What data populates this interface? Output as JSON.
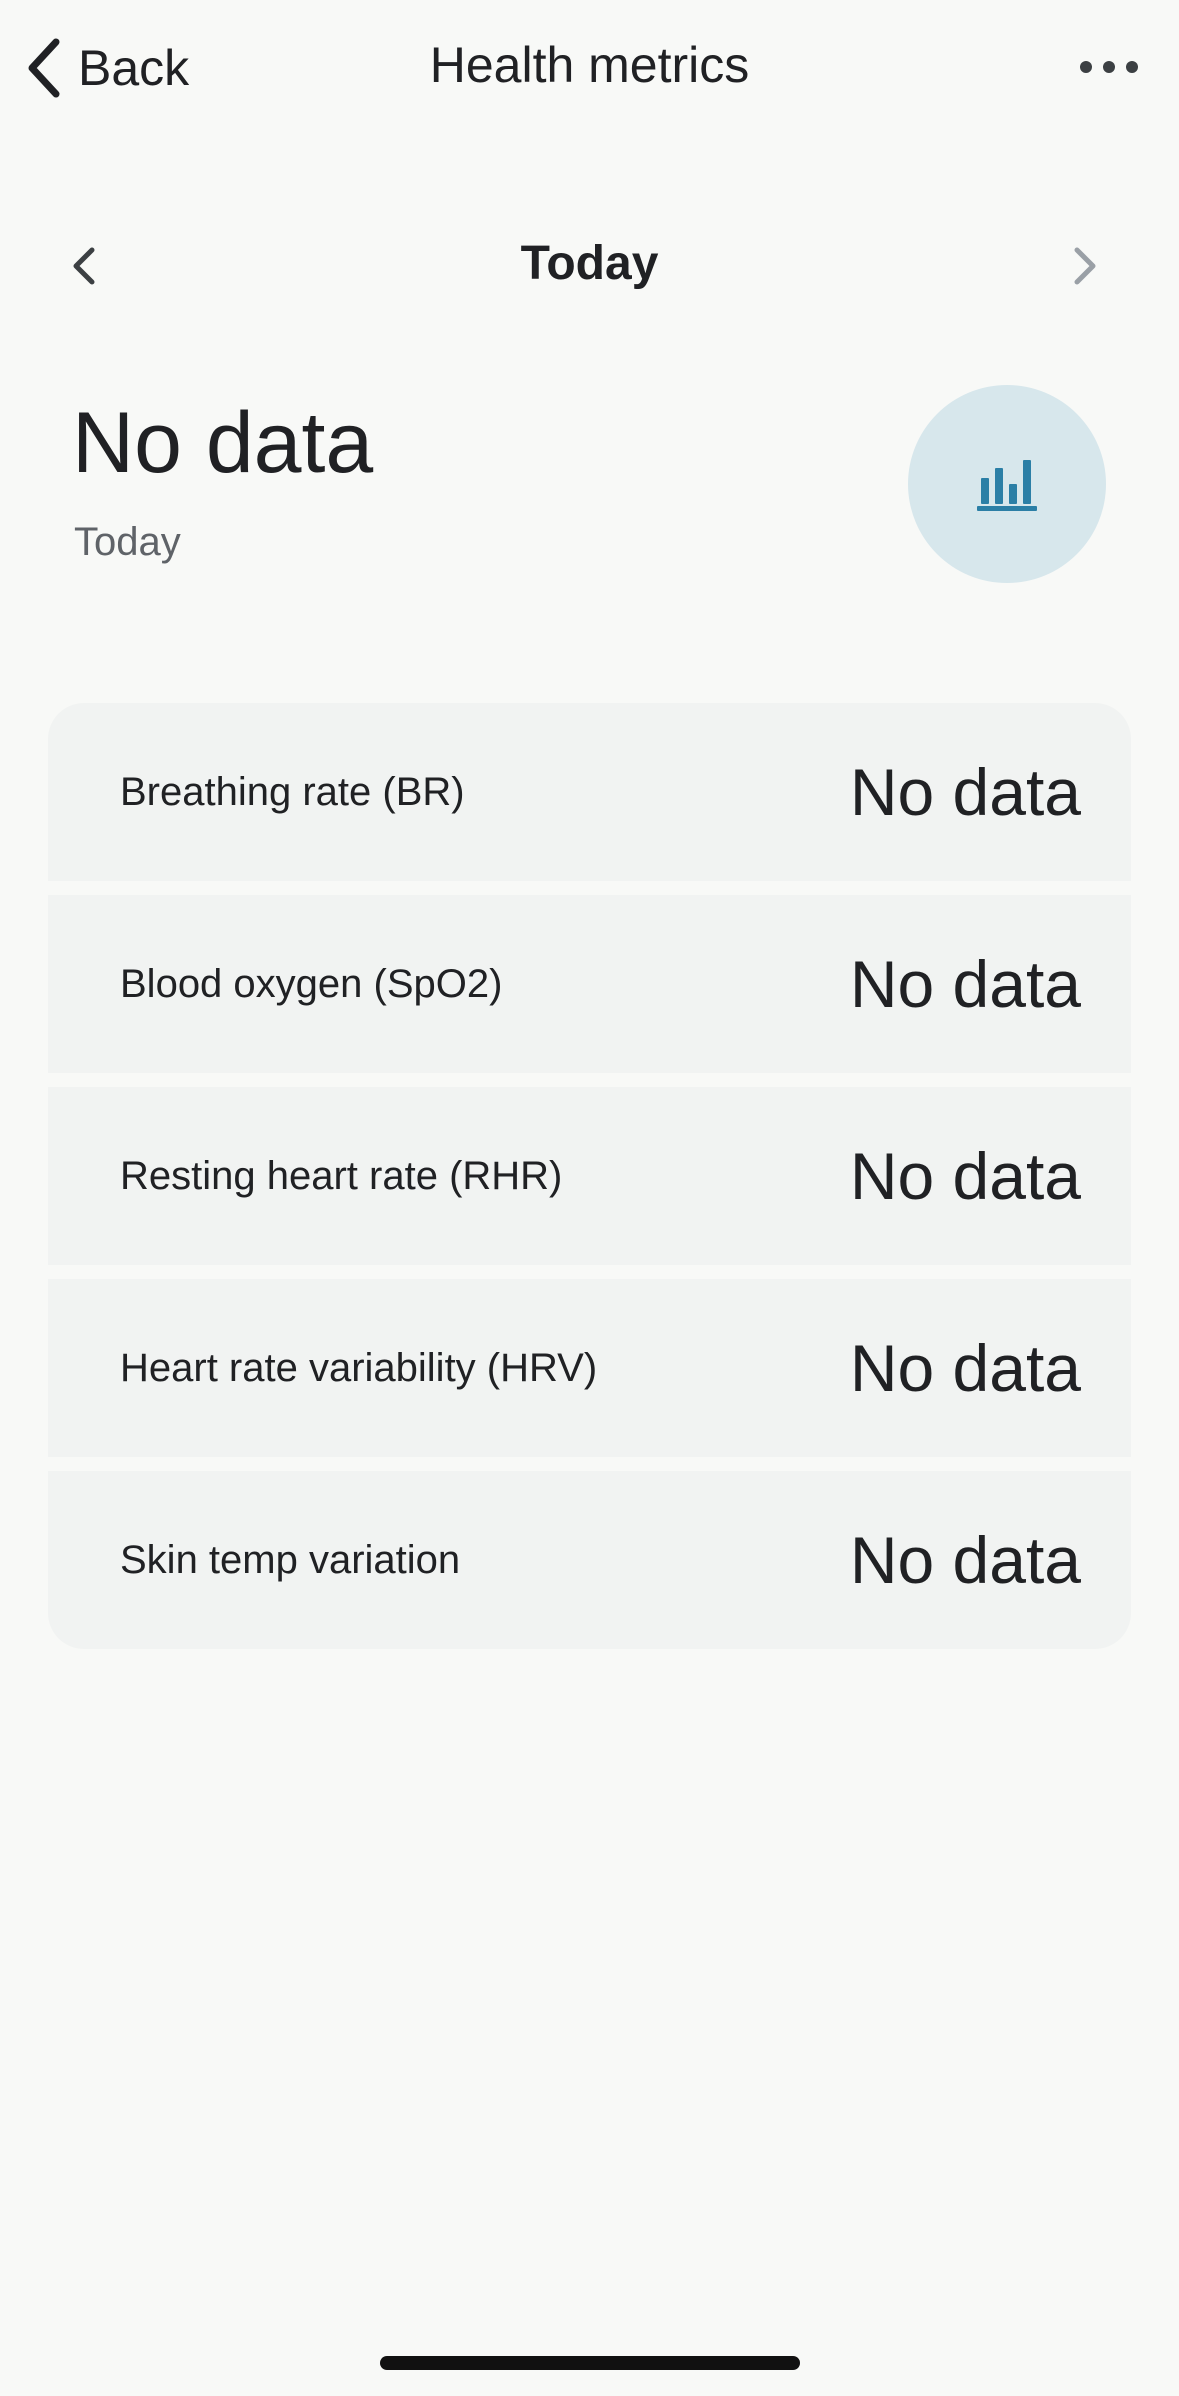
{
  "header": {
    "back_label": "Back",
    "title": "Health metrics"
  },
  "date_nav": {
    "label": "Today"
  },
  "summary": {
    "value": "No data",
    "subtitle": "Today"
  },
  "metrics": [
    {
      "label": "Breathing rate (BR)",
      "value": "No data"
    },
    {
      "label": "Blood oxygen (SpO2)",
      "value": "No data"
    },
    {
      "label": "Resting heart rate (RHR)",
      "value": "No data"
    },
    {
      "label": "Heart rate variability (HRV)",
      "value": "No data"
    },
    {
      "label": "Skin temp variation",
      "value": "No data"
    }
  ],
  "icons": {
    "back": "chevron-left-icon",
    "more": "more-horizontal-icon",
    "prev": "chevron-left-icon",
    "next": "chevron-right-icon",
    "trend": "bar-chart-icon"
  },
  "colors": {
    "background": "#f8f9f7",
    "card": "#f1f3f2",
    "trend_bg": "#d7e7ec",
    "trend_icon": "#2b7fa6",
    "text": "#202124",
    "muted": "#5f6368"
  }
}
